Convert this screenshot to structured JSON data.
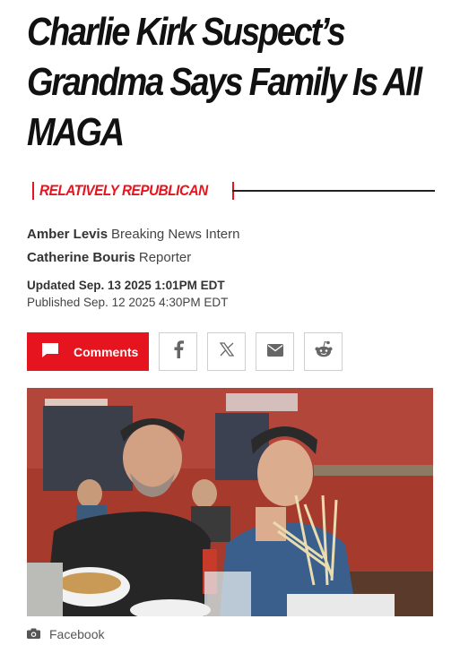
{
  "article": {
    "headline_line1": "Charlie Kirk Suspect’s",
    "headline_line2": "Grandma Says Family Is All",
    "headline_line3": "MAGA",
    "vertical": "RELATIVELY REPUBLICAN"
  },
  "authors": [
    {
      "name": "Amber Levis",
      "role": "Breaking News Intern"
    },
    {
      "name": "Catherine Bouris",
      "role": "Reporter"
    }
  ],
  "timestamps": {
    "updated": "Updated Sep. 13 2025 1:01PM EDT",
    "published": "Published Sep. 12 2025 4:30PM EDT"
  },
  "share": {
    "comments_label": "Comments",
    "icons": [
      "comment-icon",
      "facebook-icon",
      "x-icon",
      "email-icon",
      "reddit-icon"
    ]
  },
  "photo": {
    "caption": "Facebook"
  },
  "colors": {
    "accent": "#e5141e",
    "wall": "#a5382c"
  }
}
